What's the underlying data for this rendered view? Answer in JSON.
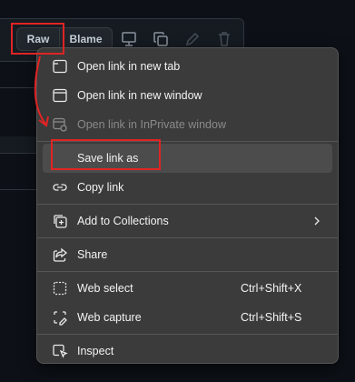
{
  "toolbar": {
    "raw_label": "Raw",
    "blame_label": "Blame"
  },
  "menu": {
    "items": [
      {
        "label": "Open link in new tab",
        "icon": "new-tab-icon"
      },
      {
        "label": "Open link in new window",
        "icon": "new-window-icon"
      },
      {
        "label": "Open link in InPrivate window",
        "icon": "inprivate-window-icon",
        "disabled": true
      },
      {
        "label": "Save link as",
        "icon": "",
        "highlighted": true
      },
      {
        "label": "Copy link",
        "icon": "link-icon"
      },
      {
        "label": "Add to Collections",
        "icon": "collections-icon",
        "submenu": true
      },
      {
        "label": "Share",
        "icon": "share-icon"
      },
      {
        "label": "Web select",
        "icon": "web-select-icon",
        "shortcut": "Ctrl+Shift+X"
      },
      {
        "label": "Web capture",
        "icon": "web-capture-icon",
        "shortcut": "Ctrl+Shift+S"
      },
      {
        "label": "Inspect",
        "icon": "inspect-icon"
      }
    ]
  },
  "colors": {
    "annotation": "#e02424",
    "menu_bg": "#3b3b3b",
    "page_bg": "#0d1117"
  }
}
